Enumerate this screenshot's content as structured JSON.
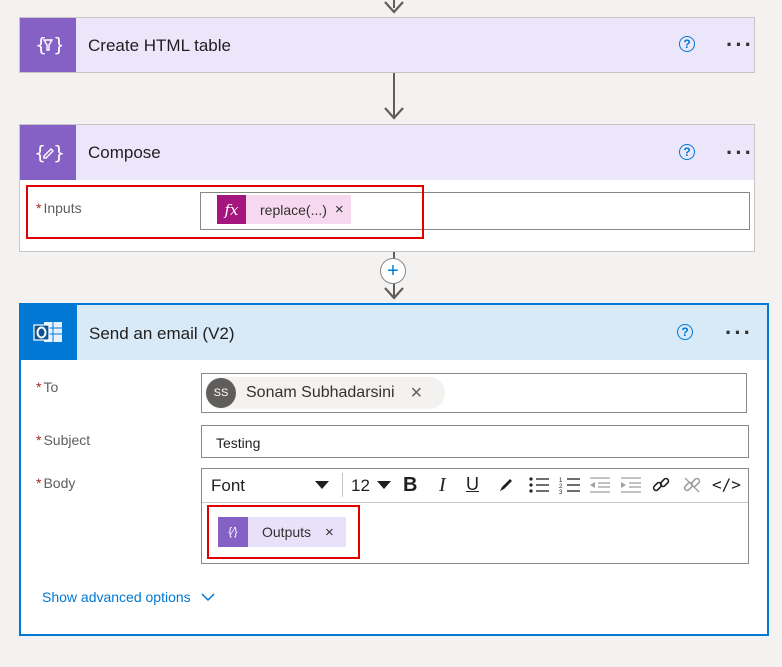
{
  "colors": {
    "accent": "#0078d4",
    "purple": "#8661c5",
    "fx": "#a4167d",
    "highlight": "#e00000"
  },
  "create_table": {
    "title": "Create HTML table",
    "icon": "data-operation-icon"
  },
  "compose": {
    "title": "Compose",
    "icon": "compose-icon",
    "inputs_label": "Inputs",
    "required_mark": "*",
    "token_label": "replace(...)",
    "token_icon_text": "fx",
    "token_remove": "×"
  },
  "add_step": {
    "symbol": "+"
  },
  "email": {
    "title": "Send an email (V2)",
    "icon": "outlook-icon",
    "to_label": "To",
    "subject_label": "Subject",
    "body_label": "Body",
    "required_mark": "*",
    "recipient_initials": "SS",
    "recipient_name": "Sonam Subhadarsini",
    "recipient_remove": "×",
    "subject_value": "Testing",
    "font_label": "Font",
    "font_size": "12",
    "body_token_label": "Outputs",
    "body_token_remove": "×",
    "advanced_label": "Show advanced options"
  },
  "common": {
    "help": "?",
    "more": "···"
  }
}
